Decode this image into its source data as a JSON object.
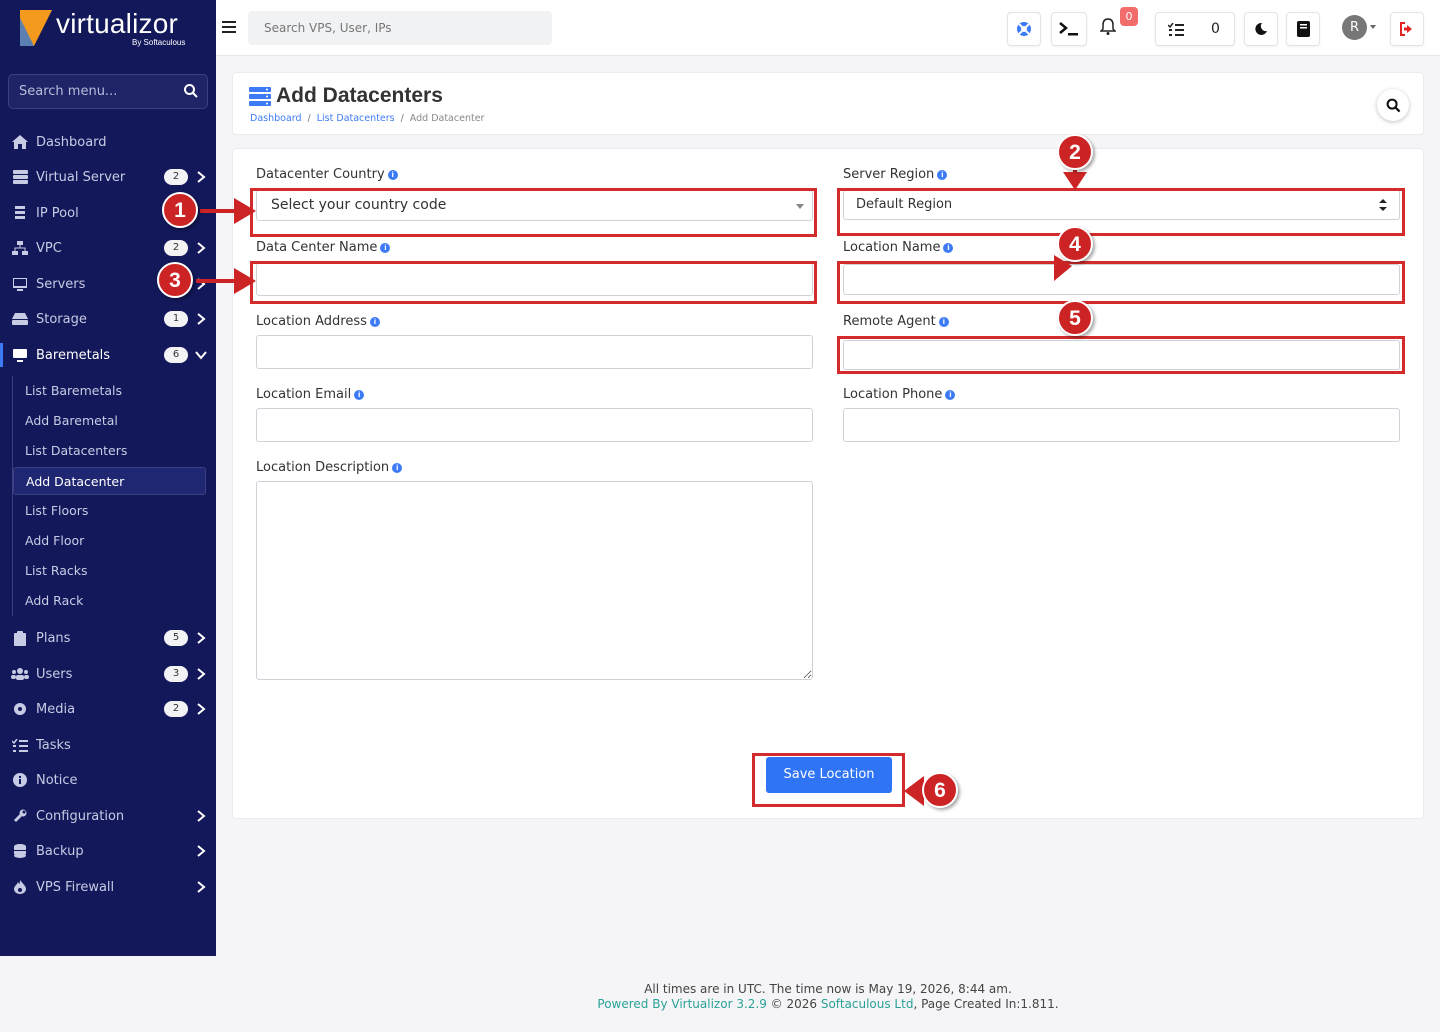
{
  "brand": {
    "name": "virtualizor",
    "sub": "By Softaculous"
  },
  "sidebar": {
    "search_placeholder": "Search menu...",
    "items": [
      {
        "label": "Dashboard"
      },
      {
        "label": "Virtual Server",
        "badge": "2"
      },
      {
        "label": "IP Pool"
      },
      {
        "label": "VPC",
        "badge": "2"
      },
      {
        "label": "Servers"
      },
      {
        "label": "Storage",
        "badge": "1"
      },
      {
        "label": "Baremetals",
        "badge": "6"
      },
      {
        "label": "Plans",
        "badge": "5"
      },
      {
        "label": "Users",
        "badge": "3"
      },
      {
        "label": "Media",
        "badge": "2"
      },
      {
        "label": "Tasks"
      },
      {
        "label": "Notice"
      },
      {
        "label": "Configuration"
      },
      {
        "label": "Backup"
      },
      {
        "label": "VPS Firewall"
      }
    ],
    "submenu": [
      {
        "label": "List Baremetals"
      },
      {
        "label": "Add Baremetal"
      },
      {
        "label": "List Datacenters"
      },
      {
        "label": "Add Datacenter"
      },
      {
        "label": "List Floors"
      },
      {
        "label": "Add Floor"
      },
      {
        "label": "List Racks"
      },
      {
        "label": "Add Rack"
      }
    ]
  },
  "topbar": {
    "search_placeholder": "Search VPS, User, IPs",
    "notif_count": "0",
    "task_count": "0",
    "avatar_letter": "R"
  },
  "header": {
    "title": "Add Datacenters",
    "breadcrumb": [
      "Dashboard",
      "List Datacenters",
      "Add Datacenter"
    ]
  },
  "form": {
    "country_label": "Datacenter Country",
    "country_value": "Select your country code",
    "region_label": "Server Region",
    "region_value": "Default Region",
    "dc_name_label": "Data Center Name",
    "loc_name_label": "Location Name",
    "loc_address_label": "Location Address",
    "remote_agent_label": "Remote Agent",
    "loc_email_label": "Location Email",
    "loc_phone_label": "Location Phone",
    "loc_desc_label": "Location Description",
    "save_label": "Save Location",
    "info_glyph": "i"
  },
  "annotations": [
    "1",
    "2",
    "3",
    "4",
    "5",
    "6"
  ],
  "footer": {
    "line1": "All times are in UTC. The time now is May 19, 2026, 8:44 am.",
    "powered": "Powered By Virtualizor 3.2.9",
    "copyright": " © 2026 ",
    "company": "Softaculous Ltd",
    "page_created": ", Page Created In:1.811."
  },
  "colors": {
    "sidebar_bg": "#13185a",
    "accent": "#2f74f5",
    "annotation": "#d32b2b"
  }
}
